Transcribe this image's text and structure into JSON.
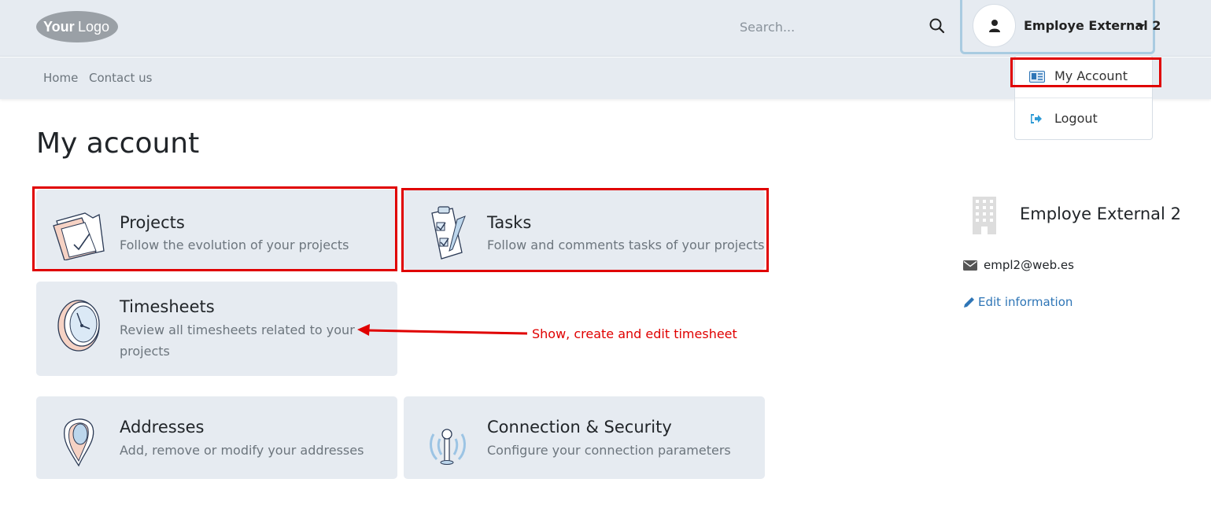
{
  "header": {
    "logo_text": "YourLogo",
    "search_placeholder": "Search...",
    "user_name": "Employe External 2"
  },
  "subnav": {
    "items": [
      "Home",
      "Contact us"
    ]
  },
  "dropdown": {
    "items": [
      {
        "label": "My Account",
        "icon": "id-card-icon"
      },
      {
        "label": "Logout",
        "icon": "sign-out-icon"
      }
    ]
  },
  "page": {
    "title": "My account"
  },
  "cards": [
    {
      "title": "Projects",
      "description": "Follow the evolution of your projects",
      "icon": "folder-check-icon"
    },
    {
      "title": "Tasks",
      "description": "Follow and comments tasks of your projects",
      "icon": "clipboard-check-icon"
    },
    {
      "title": "Timesheets",
      "description": "Review all timesheets related to your projects",
      "icon": "clock-icon"
    },
    {
      "title": "Addresses",
      "description": "Add, remove or modify your addresses",
      "icon": "map-pin-icon"
    },
    {
      "title": "Connection & Security",
      "description": "Configure your connection parameters",
      "icon": "antenna-icon"
    }
  ],
  "profile": {
    "name": "Employe External 2",
    "email": "empl2@web.es",
    "edit_label": "Edit information"
  },
  "annotation": {
    "text": "Show, create and edit timesheet"
  },
  "colors": {
    "highlight": "#e00000",
    "background": "#e6ebf1",
    "link": "#2e75b6"
  }
}
